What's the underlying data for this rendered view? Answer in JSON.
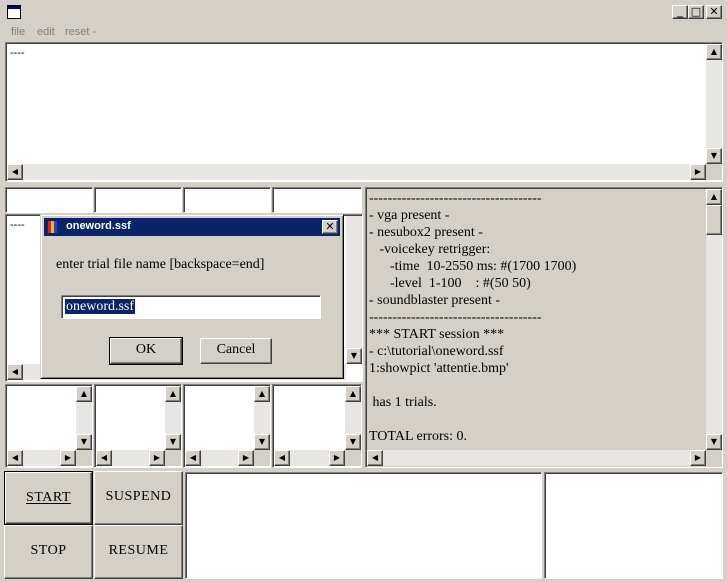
{
  "window": {
    "title": "",
    "buttons": {
      "minimize": "_",
      "maximize": "□",
      "close": "✕"
    }
  },
  "menu": {
    "items": [
      {
        "label": "file"
      },
      {
        "label": "edit"
      },
      {
        "label": "reset -"
      }
    ]
  },
  "top_output": {
    "text": "----"
  },
  "left_panel_text": "----",
  "log": {
    "text": "-------------------------------------\n- vga present -\n- nesubox2 present -\n   -voicekey retrigger:\n      -time  10-2550 ms: #(1700 1700)\n      -level  1-100    : #(50 50)\n- soundblaster present -\n-------------------------------------\n*** START session ***\n- c:\\tutorial\\oneword.ssf\n1:showpict 'attentie.bmp'\n\n has 1 trials.\n\nTOTAL errors: 0."
  },
  "controls": {
    "start": "START",
    "suspend": "SUSPEND",
    "stop": "STOP",
    "resume": "RESUME"
  },
  "dialog": {
    "title": "oneword.ssf",
    "prompt": "enter trial file name [backspace=end]",
    "input_value": "oneword.ssf",
    "ok_label": "OK",
    "cancel_label": "Cancel",
    "close_label": "✕"
  },
  "icons": {
    "app": "window-app-icon",
    "dialog": "colorful-app-icon",
    "arrow_up": "▲",
    "arrow_down": "▼",
    "arrow_left": "◀",
    "arrow_right": "▶"
  },
  "colors": {
    "face": "#d4d0c8",
    "title_active": "#0a246a",
    "selection": "#0a246a"
  }
}
